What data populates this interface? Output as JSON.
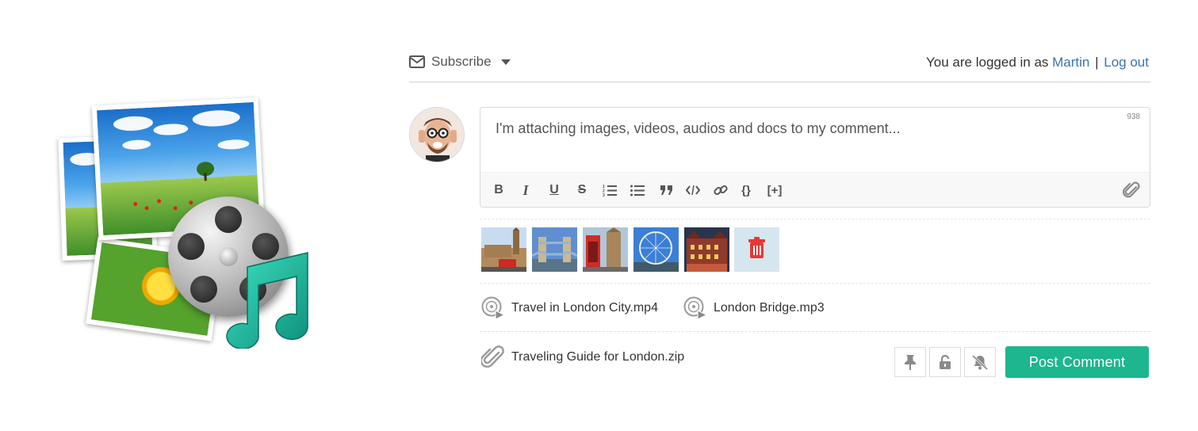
{
  "header": {
    "subscribe_label": "Subscribe",
    "logged_in_prefix": "You are logged in as",
    "user_name": "Martin",
    "separator": "|",
    "logout_label": "Log out"
  },
  "editor": {
    "text": "I'm attaching images, videos, audios and docs to my comment...",
    "char_counter": "938",
    "toolbar": {
      "bold": "B",
      "italic": "I",
      "underline": "U",
      "strike": "S",
      "code_block": "{}",
      "spoiler": "[+]"
    }
  },
  "attachments": {
    "images": [
      {
        "subject": "Westminster and Big Ben"
      },
      {
        "subject": "Tower Bridge"
      },
      {
        "subject": "Red phone box"
      },
      {
        "subject": "London Eye"
      },
      {
        "subject": "Historic building"
      },
      {
        "subject": "Delete attachment"
      }
    ],
    "media": [
      {
        "name": "Travel in London City.mp4",
        "icon": "disc-play-icon"
      },
      {
        "name": "London Bridge.mp3",
        "icon": "disc-play-icon"
      }
    ],
    "document": {
      "name": "Traveling Guide for London.zip",
      "icon": "paperclip-icon"
    }
  },
  "actions": {
    "post_label": "Post Comment"
  },
  "colors": {
    "accent": "#1db68f",
    "link": "#3a72b5",
    "trash": "#e53935"
  }
}
